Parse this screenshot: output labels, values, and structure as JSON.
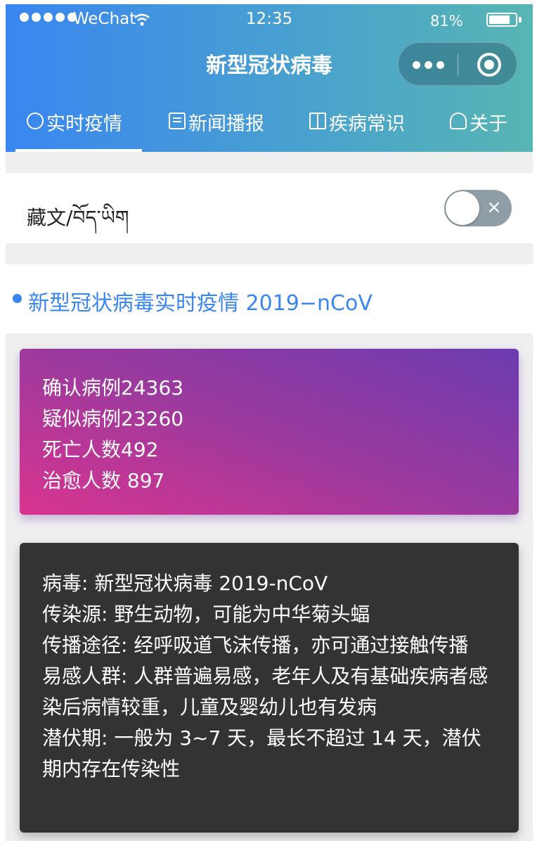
{
  "status_bar": {
    "carrier": "WeChat",
    "time": "12:35",
    "battery_percent": "81%",
    "battery_level": 0.81
  },
  "nav": {
    "title": "新型冠状病毒"
  },
  "tabs": [
    {
      "label": "实时疫情",
      "icon": "pulse-icon",
      "active": true
    },
    {
      "label": "新闻播报",
      "icon": "news-icon",
      "active": false
    },
    {
      "label": "疾病常识",
      "icon": "book-icon",
      "active": false
    },
    {
      "label": "关于",
      "icon": "user-icon",
      "active": false
    }
  ],
  "language": {
    "label": "藏文/བོད་ཡིག",
    "switch_on": false,
    "switch_glyph": "×"
  },
  "section": {
    "title": "新型冠状病毒实时疫情 2019−nCoV"
  },
  "stats": {
    "lines": [
      "确认病例24363",
      "疑似病例23260",
      "死亡人数492",
      "治愈人数 897"
    ]
  },
  "info": {
    "lines": [
      "病毒: 新型冠状病毒 2019-nCoV",
      "传染源: 野生动物，可能为中华菊头蝠",
      "传播途径: 经呼吸道飞沫传播，亦可通过接触传播",
      "易感人群: 人群普遍易感，老年人及有基础疾病者感染后病情较重，儿童及婴幼儿也有发病",
      "潜伏期: 一般为 3~7 天，最长不超过 14 天，潜伏期内存在传染性"
    ]
  },
  "colors": {
    "header_start": "#3a86f0",
    "header_end": "#57b5b3",
    "accent": "#3a86f0",
    "stats_start": "#d8348f",
    "stats_end": "#6c3bb0",
    "info_bg": "#333333"
  }
}
